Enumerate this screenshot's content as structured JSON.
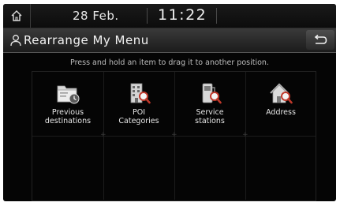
{
  "status_bar": {
    "date": "28 Feb.",
    "time": "11:22"
  },
  "header": {
    "title": "Rearrange My Menu"
  },
  "hint": "Press and hold an item to drag it to another position.",
  "menu_items": [
    {
      "label_line1": "Previous",
      "label_line2": "destinations",
      "icon": "previous-destinations-icon"
    },
    {
      "label_line1": "POI",
      "label_line2": "Categories",
      "icon": "poi-categories-icon"
    },
    {
      "label_line1": "Service",
      "label_line2": "stations",
      "icon": "service-stations-icon"
    },
    {
      "label_line1": "Address",
      "label_line2": "",
      "icon": "address-icon"
    }
  ],
  "colors": {
    "background": "#050505",
    "text": "#e6e6e6",
    "accent_red": "#c0392b"
  }
}
